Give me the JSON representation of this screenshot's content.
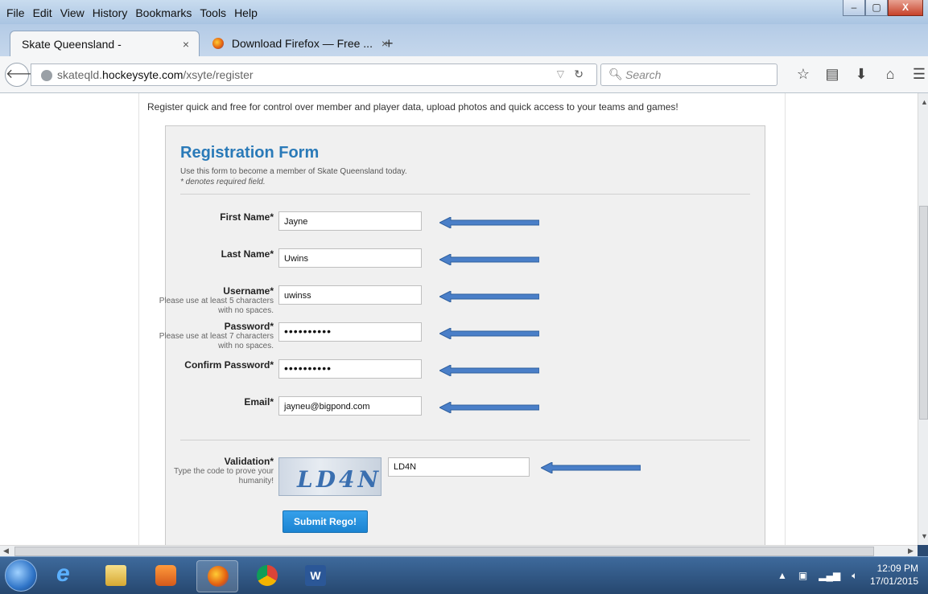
{
  "menu": [
    "File",
    "Edit",
    "View",
    "History",
    "Bookmarks",
    "Tools",
    "Help"
  ],
  "window_buttons": {
    "minimize": "–",
    "maximize": "▢",
    "close": "X"
  },
  "tabs": [
    {
      "label": "Skate Queensland -",
      "close": "×"
    },
    {
      "label": "Download Firefox — Free ...",
      "close": "×"
    }
  ],
  "new_tab": "+",
  "address": {
    "prefix": "skateqld.",
    "host": "hockeysyte.com",
    "path": "/xsyte/register"
  },
  "search": {
    "placeholder": "Search"
  },
  "page": {
    "intro": "Register quick and free for control over member and player data, upload photos and quick access to your teams and games!",
    "form_title": "Registration Form",
    "form_desc": "Use this form to become a member of Skate Queensland today.",
    "required_note": "* denotes required field.",
    "fields": [
      {
        "label": "First Name*",
        "hint": "",
        "value": "Jayne"
      },
      {
        "label": "Last Name*",
        "hint": "",
        "value": "Uwins"
      },
      {
        "label": "Username*",
        "hint": "Please use at least 5 characters with no spaces.",
        "value": "uwinss"
      },
      {
        "label": "Password*",
        "hint": "Please use at least 7 characters with no spaces.",
        "value": "••••••••••"
      },
      {
        "label": "Confirm Password*",
        "hint": "",
        "value": "••••••••••"
      },
      {
        "label": "Email*",
        "hint": "",
        "value": "jayneu@bigpond.com"
      }
    ],
    "validation": {
      "label": "Validation*",
      "hint": "Type the code to prove your humanity!",
      "captcha_text": "LD4N",
      "value": "LD4N"
    },
    "submit_label": "Submit Rego!"
  },
  "colors": {
    "accent": "#2a7ab8",
    "arrow": "#4a7fc8",
    "button": "#1b84d2"
  },
  "tray": {
    "time": "12:09 PM",
    "date": "17/01/2015"
  }
}
